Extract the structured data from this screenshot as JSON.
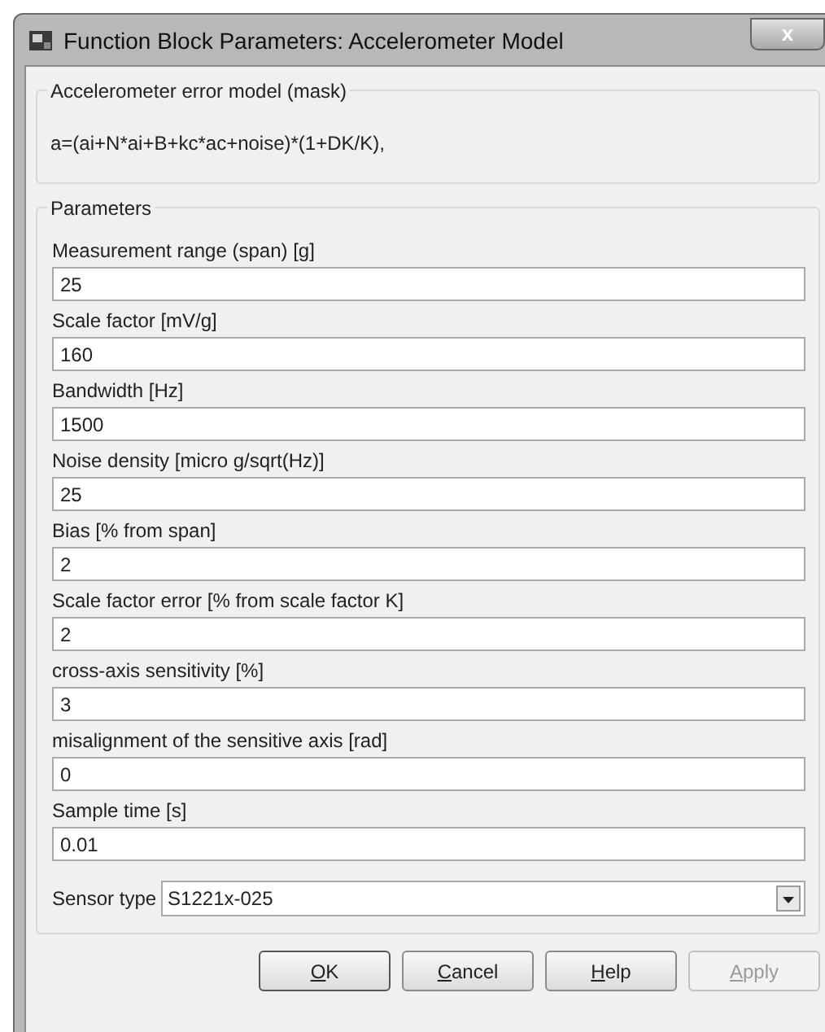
{
  "window": {
    "title": "Function Block Parameters: Accelerometer Model",
    "close": "x"
  },
  "mask": {
    "title": "Accelerometer error model (mask)",
    "formula": "a=(ai+N*ai+B+kc*ac+noise)*(1+DK/K),"
  },
  "parameters": {
    "title": "Parameters",
    "fields": [
      {
        "label": "Measurement range (span) [g]",
        "value": "25"
      },
      {
        "label": "Scale factor [mV/g]",
        "value": "160"
      },
      {
        "label": "Bandwidth  [Hz]",
        "value": "1500"
      },
      {
        "label": "Noise density [micro g/sqrt(Hz)]",
        "value": "25"
      },
      {
        "label": "Bias [% from span]",
        "value": "2"
      },
      {
        "label": "Scale factor error [% from scale factor K]",
        "value": "2"
      },
      {
        "label": "cross-axis sensitivity [%]",
        "value": "3"
      },
      {
        "label": "misalignment of the sensitive axis [rad]",
        "value": "0"
      },
      {
        "label": "Sample time [s]",
        "value": "0.01"
      }
    ],
    "dropdown": {
      "label": "Sensor type",
      "value": "S1221x-025"
    }
  },
  "buttons": [
    {
      "label": "OK",
      "disabled": false,
      "default": true
    },
    {
      "label": "Cancel",
      "disabled": false,
      "default": false
    },
    {
      "label": "Help",
      "disabled": false,
      "default": false
    },
    {
      "label": "Apply",
      "disabled": true,
      "default": false
    }
  ]
}
